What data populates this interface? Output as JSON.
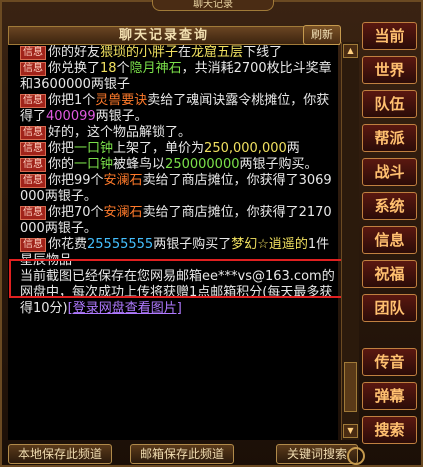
{
  "window": {
    "cap_title": "聊天记录",
    "header_title": "聊天记录查询",
    "refresh_label": "刷新"
  },
  "tag_label": "信息",
  "messages": [
    {
      "parts": [
        {
          "t": "你的好友"
        },
        {
          "t": "猥琐的小胖子",
          "c": "y"
        },
        {
          "t": "在"
        },
        {
          "t": "龙窟五层",
          "c": "y"
        },
        {
          "t": "下线了"
        }
      ]
    },
    {
      "parts": [
        {
          "t": "你兑换了"
        },
        {
          "t": "18",
          "c": "y"
        },
        {
          "t": "个"
        },
        {
          "t": "隐月神石",
          "c": "g"
        },
        {
          "t": "，共消耗2700枚比斗奖章和3600000两银子"
        }
      ]
    },
    {
      "parts": [
        {
          "t": "你把1个"
        },
        {
          "t": "灵兽要诀",
          "c": "o"
        },
        {
          "t": "卖给了魂闻诀露令桃摊位，你获得了"
        },
        {
          "t": "400099",
          "c": "p"
        },
        {
          "t": "两银子。"
        }
      ]
    },
    {
      "parts": [
        {
          "t": "好的，这个物品解锁了。"
        }
      ]
    },
    {
      "parts": [
        {
          "t": "你把"
        },
        {
          "t": "一口钟",
          "c": "g"
        },
        {
          "t": "上架了，单价为"
        },
        {
          "t": "250,000,000",
          "c": "y"
        },
        {
          "t": "两"
        }
      ]
    },
    {
      "parts": [
        {
          "t": "你的"
        },
        {
          "t": "一口钟",
          "c": "g"
        },
        {
          "t": "被蜂鸟以"
        },
        {
          "t": "250000000",
          "c": "g"
        },
        {
          "t": "两银子购买。"
        }
      ]
    },
    {
      "parts": [
        {
          "t": "你把99个"
        },
        {
          "t": "安澜石",
          "c": "o"
        },
        {
          "t": "卖给了商店摊位，你获得了3069000两银子。"
        }
      ]
    },
    {
      "parts": [
        {
          "t": "你把70个"
        },
        {
          "t": "安澜石",
          "c": "o"
        },
        {
          "t": "卖给了商店摊位，你获得了2170000两银子。"
        }
      ]
    },
    {
      "parts": [
        {
          "t": "你花费"
        },
        {
          "t": "25555555",
          "c": "c"
        },
        {
          "t": "两银子购买了"
        },
        {
          "t": "梦幻☆逍遥的",
          "c": "y"
        },
        {
          "t": "1件星辰物品"
        }
      ]
    },
    {
      "notag": true,
      "parts": [
        {
          "t": "当前截图已经保存在您网易邮箱"
        },
        {
          "t": "ee***vs@163.com"
        },
        {
          "t": "的网盘中，每次成功上传将获赠1点邮箱积分(每天最多获得10分)"
        },
        {
          "t": "[登录网盘查看图片]",
          "c": "link"
        }
      ]
    }
  ],
  "sidebar": [
    {
      "label": "当前"
    },
    {
      "label": "世界"
    },
    {
      "label": "队伍"
    },
    {
      "label": "帮派"
    },
    {
      "label": "战斗"
    },
    {
      "label": "系统"
    },
    {
      "label": "信息"
    },
    {
      "label": "祝福"
    },
    {
      "label": "团队"
    },
    {
      "label": "传音"
    },
    {
      "label": "弹幕"
    },
    {
      "label": "搜索"
    }
  ],
  "bottom": {
    "local_save": "本地保存此频道",
    "mail_save": "邮箱保存此频道",
    "keyword_search": "关键词搜索"
  }
}
